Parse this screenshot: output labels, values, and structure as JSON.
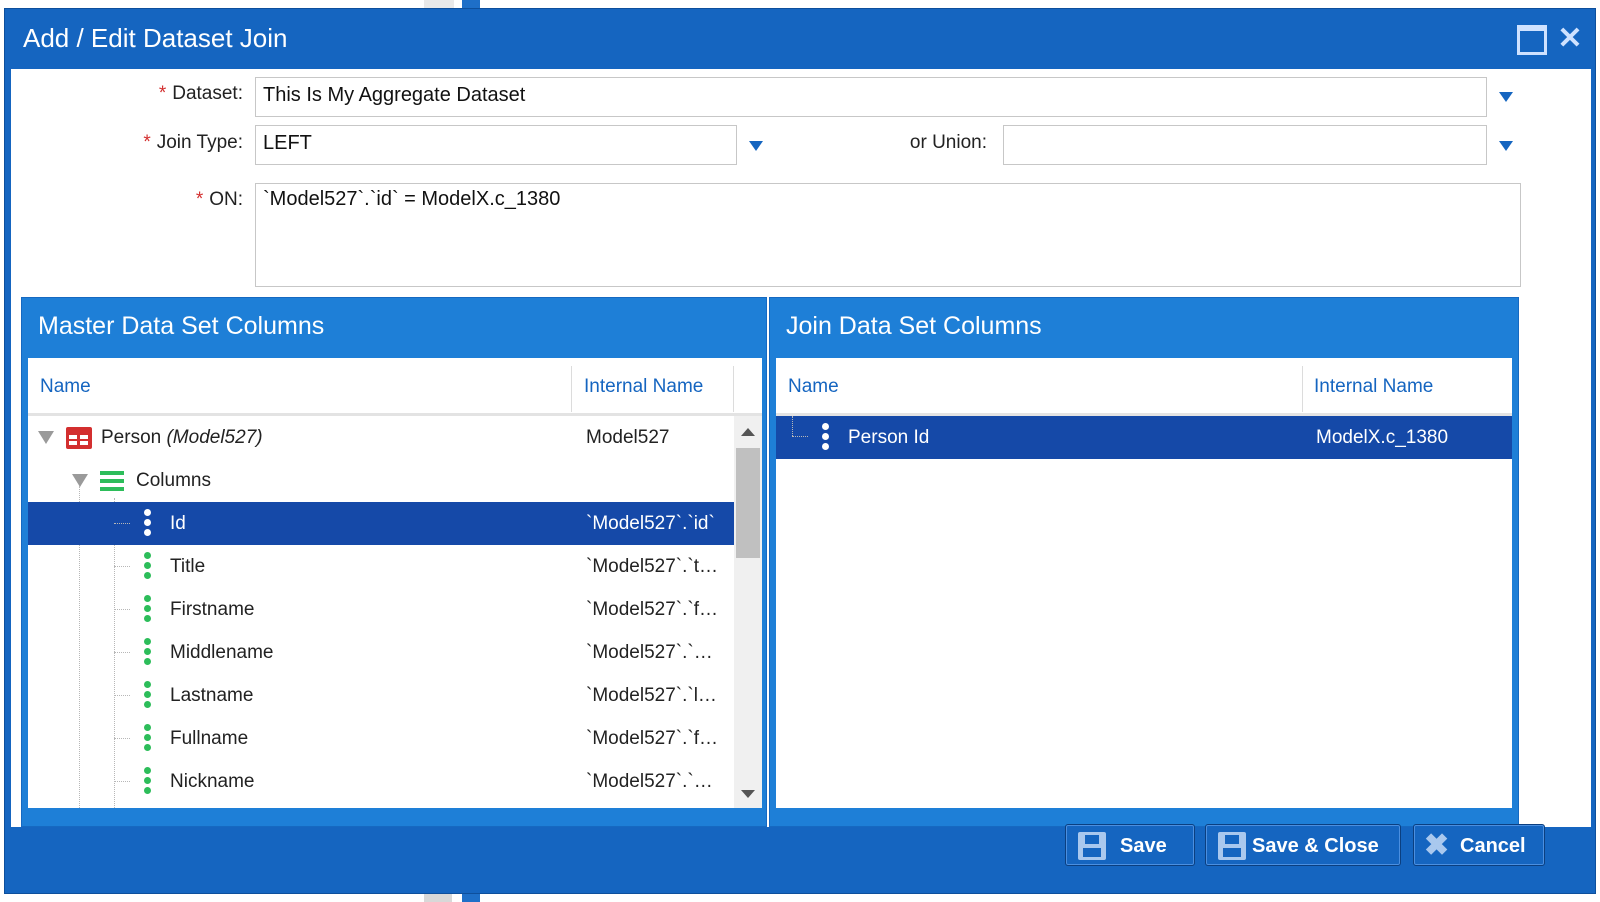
{
  "dialog": {
    "title": "Add / Edit Dataset Join",
    "maximize_icon": "maximize-icon",
    "close_icon": "close-icon"
  },
  "form": {
    "dataset_label": "Dataset:",
    "dataset_value": "This Is My Aggregate Dataset",
    "join_type_label": "Join Type:",
    "join_type_value": "LEFT",
    "union_label": "or Union:",
    "union_value": "",
    "on_label": "ON:",
    "on_value": "`Model527`.`id` = ModelX.c_1380",
    "required_mark": "*"
  },
  "master": {
    "title": "Master Data Set Columns",
    "col_name": "Name",
    "col_internal": "Internal Name",
    "root": {
      "name": "Person ",
      "model": "(Model527)",
      "internal": "Model527"
    },
    "group": "Columns",
    "items": [
      {
        "name": "Id",
        "internal": "`Model527`.`id`",
        "selected": true
      },
      {
        "name": "Title",
        "internal": "`Model527`.`t…"
      },
      {
        "name": "Firstname",
        "internal": "`Model527`.`f…"
      },
      {
        "name": "Middlename",
        "internal": "`Model527`.`…"
      },
      {
        "name": "Lastname",
        "internal": "`Model527`.`l…"
      },
      {
        "name": "Fullname",
        "internal": "`Model527`.`f…"
      },
      {
        "name": "Nickname",
        "internal": "`Model527`.`…"
      }
    ]
  },
  "join": {
    "title": "Join Data Set Columns",
    "col_name": "Name",
    "col_internal": "Internal Name",
    "items": [
      {
        "name": "Person Id",
        "internal": "ModelX.c_1380",
        "selected": true
      }
    ]
  },
  "footer": {
    "save": "Save",
    "save_close": "Save & Close",
    "cancel": "Cancel"
  },
  "colors": {
    "primary": "#1565c0",
    "selected_row": "#1549a8",
    "column_icon": "#2dbd5a",
    "table_icon": "#d32f2f"
  }
}
